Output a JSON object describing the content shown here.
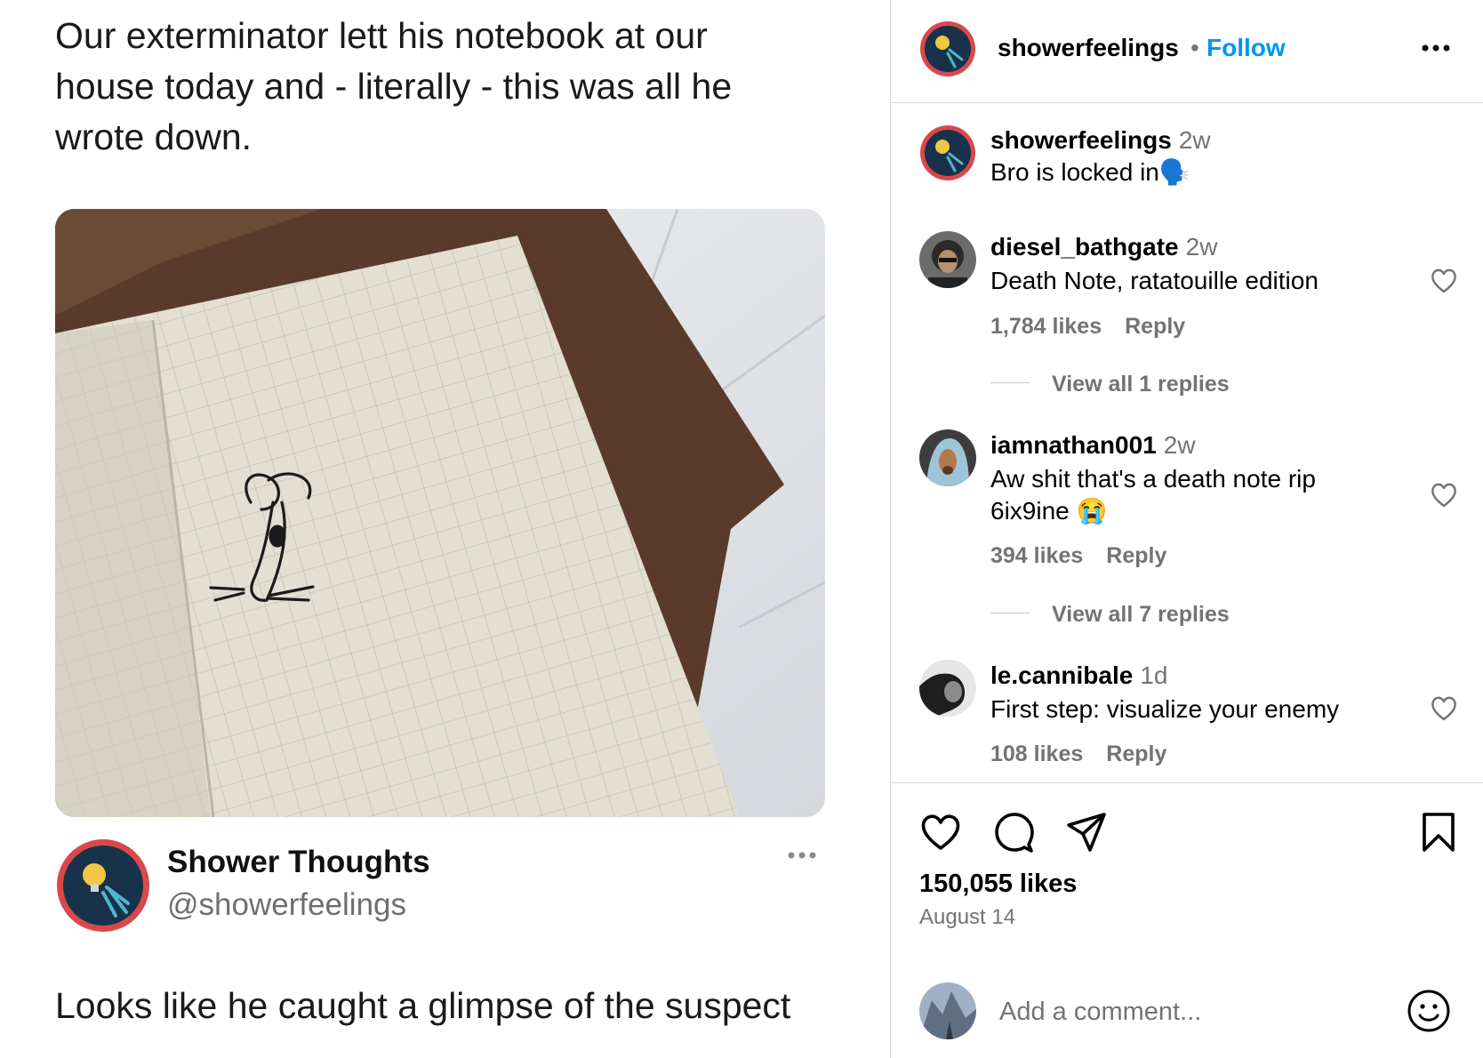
{
  "tweet": {
    "text": "Our exterminator lett his notebook at our house today and - literally - this was all he wrote down.",
    "author_name": "Shower Thoughts",
    "author_handle": "@showerfeelings",
    "reply_text": "Looks like he caught a glimpse of the suspect"
  },
  "header": {
    "username": "showerfeelings",
    "separator": "•",
    "follow_label": "Follow"
  },
  "caption": {
    "username": "showerfeelings",
    "time": "2w",
    "text": "Bro is locked in🗣️"
  },
  "comments": [
    {
      "username": "diesel_bathgate",
      "time": "2w",
      "text": "Death Note, ratatouille edition",
      "likes": "1,784 likes",
      "reply_label": "Reply",
      "view_replies": "View all 1 replies"
    },
    {
      "username": "iamnathan001",
      "time": "2w",
      "text": "Aw shit that's a death note rip 6ix9ine 😭",
      "likes": "394 likes",
      "reply_label": "Reply",
      "view_replies": "View all 7 replies"
    },
    {
      "username": "le.cannibale",
      "time": "1d",
      "text": "First step: visualize your enemy",
      "likes": "108 likes",
      "reply_label": "Reply"
    }
  ],
  "post": {
    "likes": "150,055 likes",
    "date": "August 14"
  },
  "add_comment": {
    "placeholder": "Add a comment..."
  },
  "icons": {
    "like": "heart-icon",
    "comment": "comment-icon",
    "share": "share-icon",
    "save": "bookmark-icon",
    "more": "more-icon",
    "emoji": "emoji-icon"
  },
  "colors": {
    "follow": "#0095f6",
    "secondary_text": "#737373",
    "avatar_ring": "#d9484c",
    "avatar_bg": "#17324a"
  }
}
